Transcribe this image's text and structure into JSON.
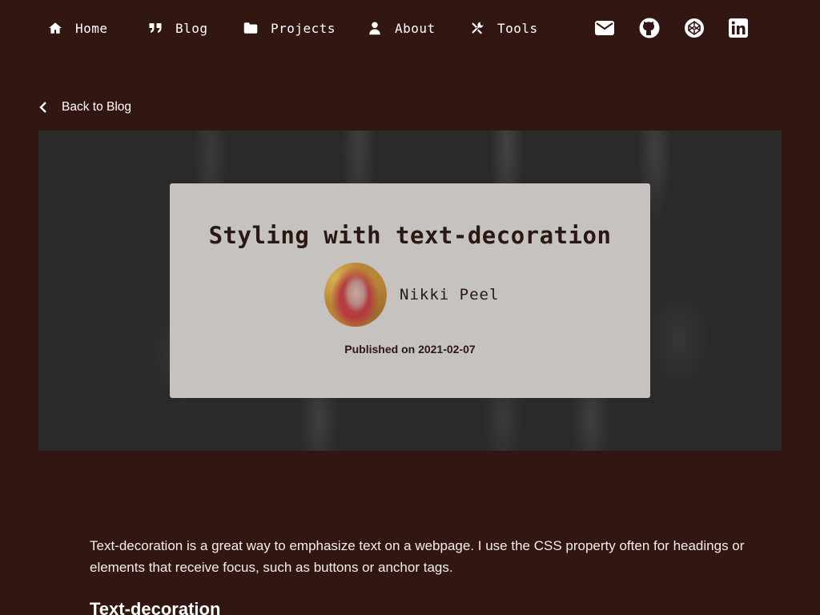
{
  "nav": {
    "items": [
      {
        "label": "Home",
        "icon": "home-icon"
      },
      {
        "label": "Blog",
        "icon": "quote-icon"
      },
      {
        "label": "Projects",
        "icon": "folder-icon"
      },
      {
        "label": "About",
        "icon": "user-icon"
      },
      {
        "label": "Tools",
        "icon": "tools-icon"
      }
    ],
    "social": [
      "envelope-icon",
      "github-icon",
      "codepen-icon",
      "linkedin-icon"
    ]
  },
  "back_link": {
    "label": "Back to Blog",
    "icon": "chevron-left-icon"
  },
  "post": {
    "title": "Styling with text-decoration",
    "author": "Nikki Peel",
    "published": "Published on 2021-02-07"
  },
  "article": {
    "intro": "Text-decoration is a great way to emphasize text on a webpage. I use the CSS property often for headings or elements that receive focus, such as buttons or anchor tags.",
    "heading": "Text-decoration"
  },
  "colors": {
    "background": "#321612",
    "hero": "#2a2a2a",
    "card": "#c6c2bf",
    "text": "#f4eeec"
  }
}
